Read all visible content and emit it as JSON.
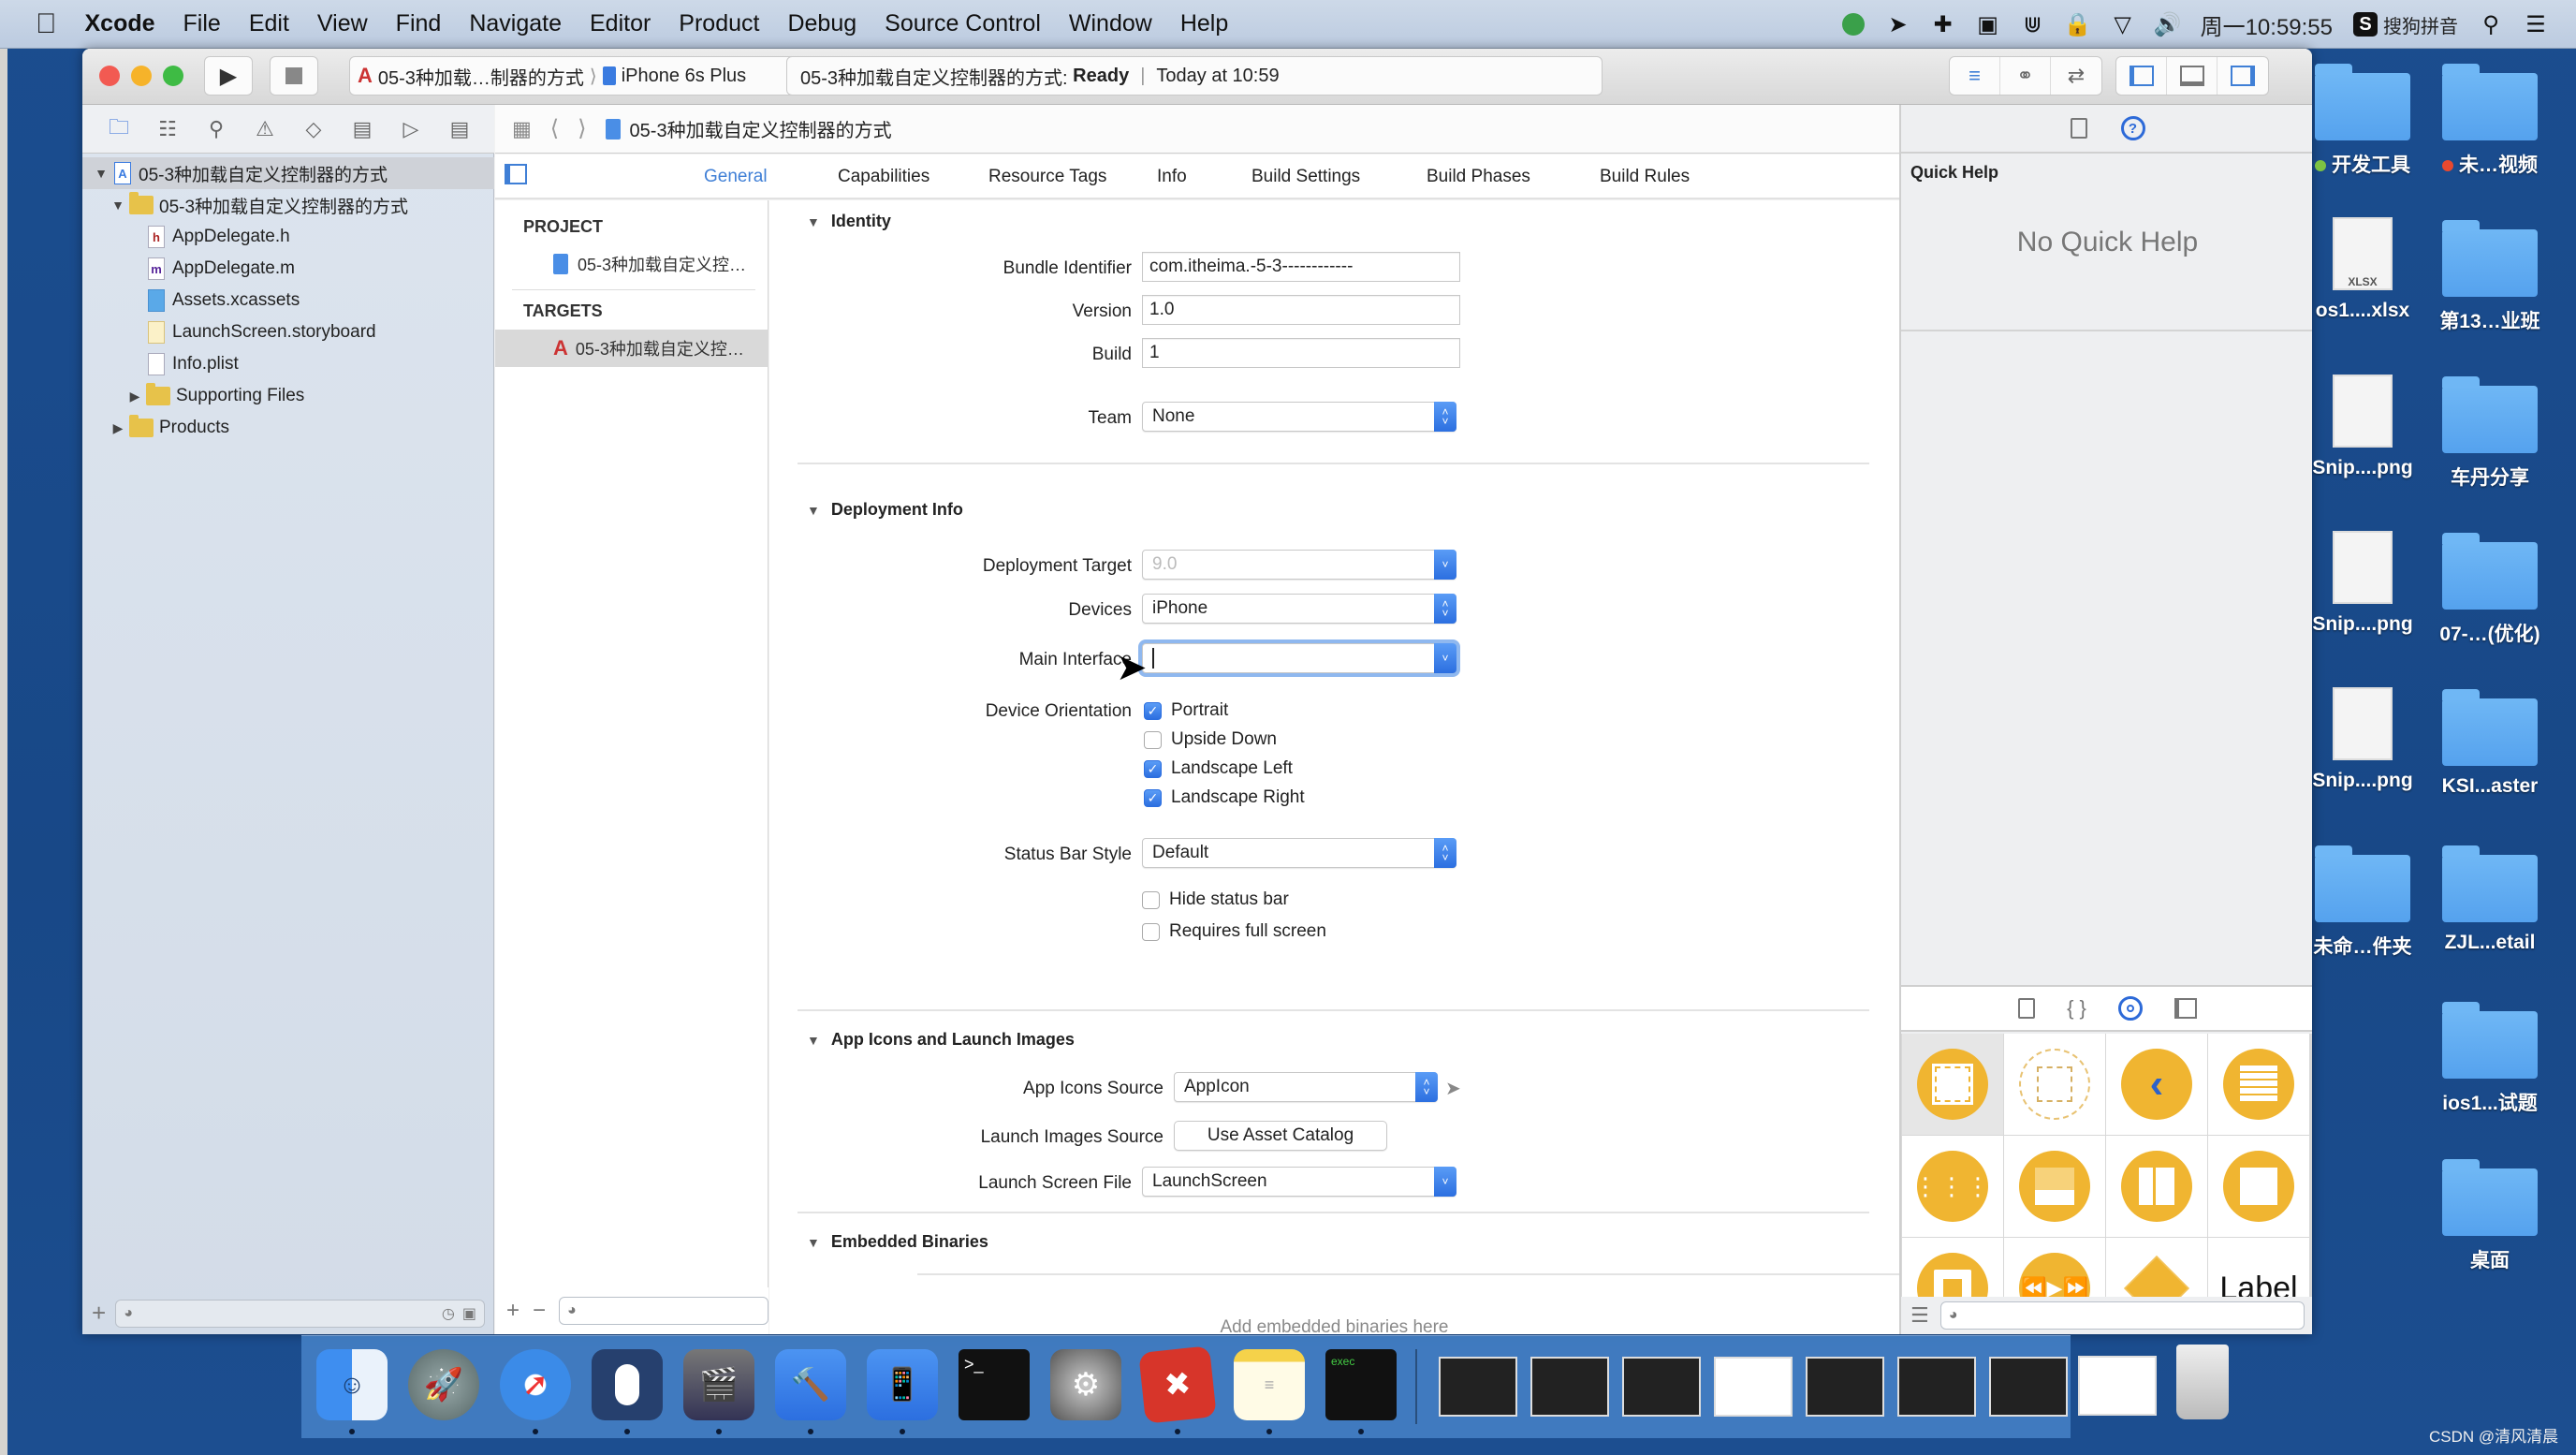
{
  "menubar": {
    "apple_icon": "apple-logo",
    "app_name": "Xcode",
    "items": [
      "File",
      "Edit",
      "View",
      "Find",
      "Navigate",
      "Editor",
      "Product",
      "Debug",
      "Source Control",
      "Window",
      "Help"
    ],
    "clock": "周一10:59:55",
    "input_method": "搜狗拼音",
    "status_icons": [
      "screen-recorder-icon",
      "location-icon",
      "airplane-icon",
      "camera-icon",
      "bluetooth-icon",
      "lock-icon",
      "wifi-icon",
      "volume-icon"
    ]
  },
  "toolbar": {
    "scheme": "05-3种加载…制器的方式",
    "device": "iPhone 6s Plus",
    "activity_project": "05-3种加载自定义控制器的方式:",
    "activity_status": "Ready",
    "activity_time": "Today at 10:59"
  },
  "navigator": {
    "tree": [
      {
        "label": "05-3种加载自定义控制器的方式",
        "type": "project",
        "level": 0,
        "expanded": true,
        "selected": true
      },
      {
        "label": "05-3种加载自定义控制器的方式",
        "type": "folder",
        "level": 1,
        "expanded": true
      },
      {
        "label": "AppDelegate.h",
        "type": "h",
        "level": 2
      },
      {
        "label": "AppDelegate.m",
        "type": "m",
        "level": 2
      },
      {
        "label": "Assets.xcassets",
        "type": "assets",
        "level": 2
      },
      {
        "label": "LaunchScreen.storyboard",
        "type": "storyboard",
        "level": 2
      },
      {
        "label": "Info.plist",
        "type": "plist",
        "level": 2
      },
      {
        "label": "Supporting Files",
        "type": "folder",
        "level": 2,
        "expanded": false
      },
      {
        "label": "Products",
        "type": "folder",
        "level": 1,
        "expanded": false
      }
    ]
  },
  "jumpbar": {
    "path": "05-3种加载自定义控制器的方式"
  },
  "targets_list": {
    "project_header": "PROJECT",
    "project_item": "05-3种加载自定义控…",
    "targets_header": "TARGETS",
    "target_item": "05-3种加载自定义控…"
  },
  "editor_tabs": [
    "General",
    "Capabilities",
    "Resource Tags",
    "Info",
    "Build Settings",
    "Build Phases",
    "Build Rules"
  ],
  "editor_tabs_active": "General",
  "identity": {
    "title": "Identity",
    "bundle_identifier_label": "Bundle Identifier",
    "bundle_identifier": "com.itheima.-5-3------------",
    "version_label": "Version",
    "version": "1.0",
    "build_label": "Build",
    "build": "1",
    "team_label": "Team",
    "team": "None"
  },
  "deployment": {
    "title": "Deployment Info",
    "target_label": "Deployment Target",
    "target": "9.0",
    "devices_label": "Devices",
    "devices": "iPhone",
    "main_interface_label": "Main Interface",
    "main_interface": "",
    "orientation_label": "Device Orientation",
    "orientations": [
      {
        "label": "Portrait",
        "checked": true
      },
      {
        "label": "Upside Down",
        "checked": false
      },
      {
        "label": "Landscape Left",
        "checked": true
      },
      {
        "label": "Landscape Right",
        "checked": true
      }
    ],
    "status_bar_label": "Status Bar Style",
    "status_bar": "Default",
    "hide_status_bar": {
      "label": "Hide status bar",
      "checked": false
    },
    "requires_full_screen": {
      "label": "Requires full screen",
      "checked": false
    }
  },
  "app_icons": {
    "title": "App Icons and Launch Images",
    "icons_source_label": "App Icons Source",
    "icons_source": "AppIcon",
    "launch_images_label": "Launch Images Source",
    "launch_images_button": "Use Asset Catalog",
    "launch_screen_label": "Launch Screen File",
    "launch_screen": "LaunchScreen"
  },
  "embedded": {
    "title": "Embedded Binaries",
    "empty": "Add embedded binaries here"
  },
  "inspector": {
    "quick_help_title": "Quick Help",
    "quick_help_empty": "No Quick Help",
    "library_items": [
      "View Controller",
      "Storyboard Reference",
      "Navigation Controller",
      "Table View Controller",
      "Collection View Controller",
      "Tab Bar Controller",
      "Split View Controller",
      "Page View Controller",
      "GLKit View Controller",
      "AVKit Player View Controller",
      "Object",
      "Label"
    ]
  },
  "desktop_icons": [
    {
      "label": "开发工具",
      "kind": "folder",
      "tag": "#7cc243"
    },
    {
      "label": "未…视频",
      "kind": "folder",
      "tag": "#e8492f"
    },
    {
      "label": "os1....xlsx",
      "kind": "xlsx"
    },
    {
      "label": "第13…业班",
      "kind": "folder"
    },
    {
      "label": "Snip....png",
      "kind": "image"
    },
    {
      "label": "车丹分享",
      "kind": "folder"
    },
    {
      "label": "Snip....png",
      "kind": "image"
    },
    {
      "label": "07-…(优化)",
      "kind": "folder"
    },
    {
      "label": "Snip....png",
      "kind": "image"
    },
    {
      "label": "KSI...aster",
      "kind": "folder"
    },
    {
      "label": "未命…件夹",
      "kind": "folder"
    },
    {
      "label": "ZJL...etail",
      "kind": "folder"
    },
    {
      "label": "ios1...试题",
      "kind": "folder"
    },
    {
      "label": "桌面",
      "kind": "folder"
    }
  ],
  "dock": {
    "apps": [
      "Finder",
      "Launchpad",
      "Safari",
      "Mouse",
      "Movie Player",
      "Xcode",
      "Simulator",
      "Terminal",
      "System Preferences",
      "XMind",
      "Notes",
      "Console"
    ]
  },
  "watermark": "CSDN @清风清晨"
}
